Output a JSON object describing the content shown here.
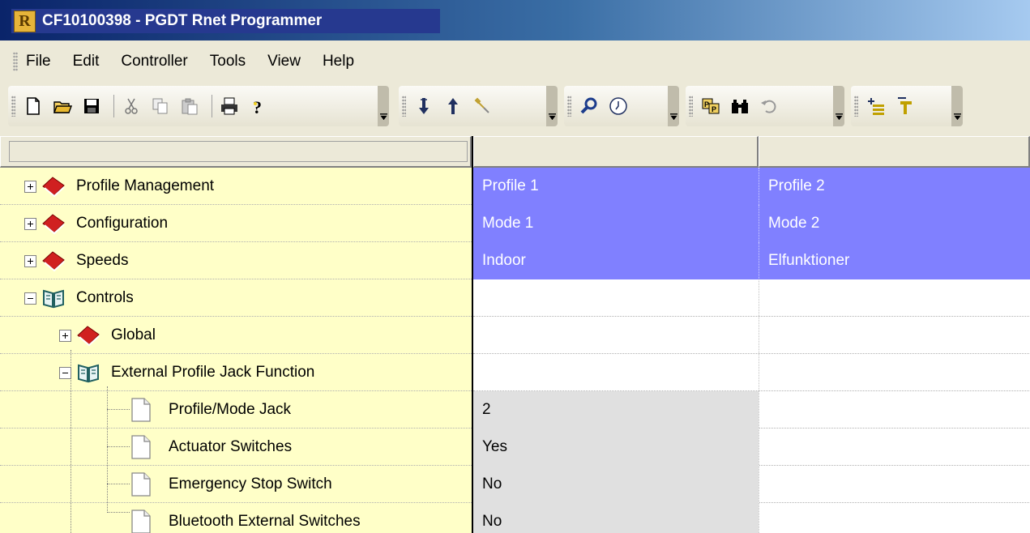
{
  "window": {
    "app_icon_letter": "R",
    "title": "CF10100398 - PGDT Rnet Programmer"
  },
  "menu": [
    "File",
    "Edit",
    "Controller",
    "Tools",
    "View",
    "Help"
  ],
  "toolbar_groups": [
    [
      "new-icon",
      "open-icon",
      "save-icon",
      "cut-icon",
      "copy-icon",
      "paste-icon",
      "print-icon",
      "help-icon"
    ],
    [
      "download-icon",
      "upload-icon",
      "wrench-connect-icon"
    ],
    [
      "search-tool-icon",
      "clock-icon"
    ],
    [
      "profile-icon",
      "binoculars-icon",
      "undo-icon"
    ],
    [
      "insert-row-icon",
      "filter-icon"
    ]
  ],
  "tree": [
    {
      "label": "Profile Management",
      "icon": "closed-book-icon",
      "expander": "plus",
      "level": 0
    },
    {
      "label": "Configuration",
      "icon": "closed-book-icon",
      "expander": "plus",
      "level": 0
    },
    {
      "label": "Speeds",
      "icon": "closed-book-icon",
      "expander": "plus",
      "level": 0
    },
    {
      "label": "Controls",
      "icon": "open-book-icon",
      "expander": "minus",
      "level": 0
    },
    {
      "label": "Global",
      "icon": "closed-book-icon",
      "expander": "plus",
      "level": 1
    },
    {
      "label": "External Profile Jack Function",
      "icon": "open-book-icon",
      "expander": "minus",
      "level": 1
    },
    {
      "label": "Profile/Mode Jack",
      "icon": "document-icon",
      "level": 2
    },
    {
      "label": "Actuator Switches",
      "icon": "document-icon",
      "level": 2
    },
    {
      "label": "Emergency Stop Switch",
      "icon": "document-icon",
      "level": 2
    },
    {
      "label": "Bluetooth External Switches",
      "icon": "document-icon",
      "level": 2
    }
  ],
  "values": [
    [
      "Profile 1",
      "Profile 2"
    ],
    [
      "Mode 1",
      "Mode 2"
    ],
    [
      "Indoor",
      "Elfunktioner"
    ],
    [
      "",
      ""
    ],
    [
      "",
      ""
    ],
    [
      "",
      ""
    ],
    [
      "2",
      ""
    ],
    [
      "Yes",
      ""
    ],
    [
      "No",
      ""
    ],
    [
      "No",
      ""
    ]
  ],
  "colors": {
    "tree_background": "#ffffc8",
    "selected_row": "#8080ff",
    "value_cell": "#e0e0e0",
    "title_bar": "#26398f"
  }
}
